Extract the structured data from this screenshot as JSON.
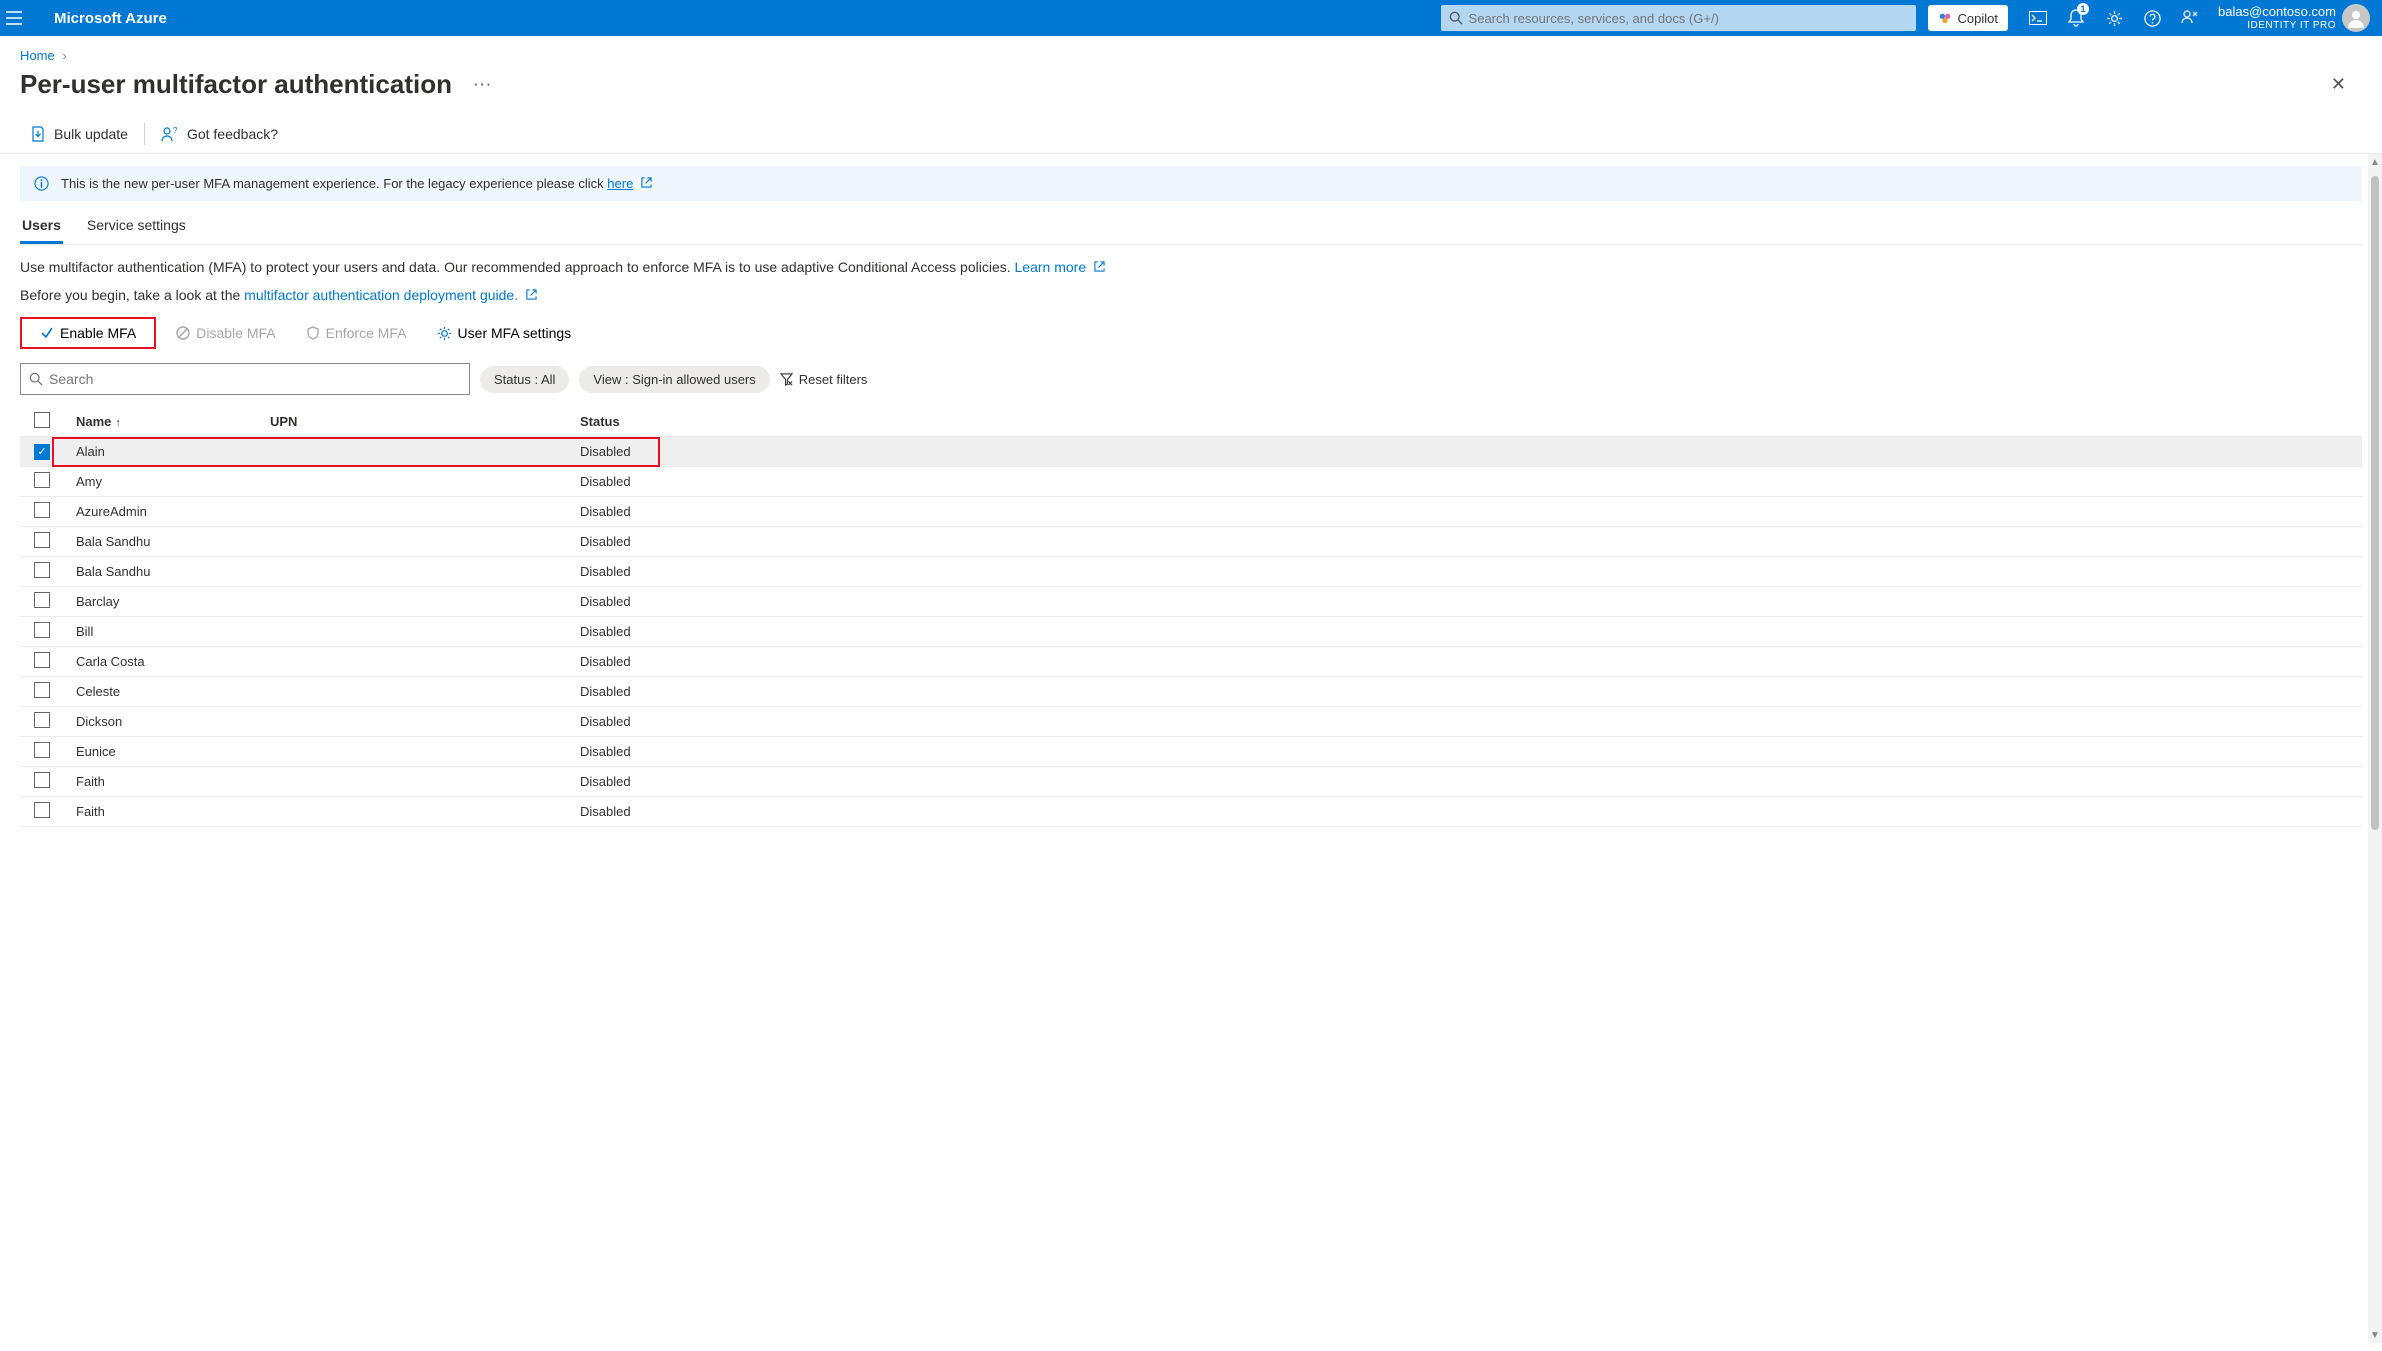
{
  "header": {
    "brand": "Microsoft Azure",
    "search_placeholder": "Search resources, services, and docs (G+/)",
    "copilot_label": "Copilot",
    "notification_badge": "1",
    "account_email": "balas@contoso.com",
    "account_role": "IDENTITY IT PRO"
  },
  "breadcrumb": {
    "home": "Home"
  },
  "page": {
    "title": "Per-user multifactor authentication"
  },
  "commandbar": {
    "bulk_update": "Bulk update",
    "got_feedback": "Got feedback?"
  },
  "banner": {
    "text_prefix": "This is the new per-user MFA management experience. For the legacy experience please click",
    "link_text": "here"
  },
  "tabs": {
    "users": "Users",
    "service_settings": "Service settings"
  },
  "desc": {
    "line1a": "Use multifactor authentication (MFA) to protect your users and data. Our recommended approach to enforce MFA is to use adaptive Conditional Access policies. ",
    "learn_more": "Learn more",
    "line2a": "Before you begin, take a look at the ",
    "guide_link": "multifactor authentication deployment guide."
  },
  "actions": {
    "enable_mfa": "Enable MFA",
    "disable_mfa": "Disable MFA",
    "enforce_mfa": "Enforce MFA",
    "user_mfa_settings": "User MFA settings"
  },
  "filters": {
    "search_placeholder": "Search",
    "status_pill": "Status : All",
    "view_pill": "View : Sign-in allowed users",
    "reset": "Reset filters"
  },
  "table": {
    "headers": {
      "name": "Name",
      "upn": "UPN",
      "status": "Status"
    },
    "rows": [
      {
        "name": "Alain",
        "upn": "",
        "status": "Disabled",
        "checked": true
      },
      {
        "name": "Amy",
        "upn": "",
        "status": "Disabled",
        "checked": false
      },
      {
        "name": "AzureAdmin",
        "upn": "",
        "status": "Disabled",
        "checked": false
      },
      {
        "name": "Bala Sandhu",
        "upn": "",
        "status": "Disabled",
        "checked": false
      },
      {
        "name": "Bala Sandhu",
        "upn": "",
        "status": "Disabled",
        "checked": false
      },
      {
        "name": "Barclay",
        "upn": "",
        "status": "Disabled",
        "checked": false
      },
      {
        "name": "Bill",
        "upn": "",
        "status": "Disabled",
        "checked": false
      },
      {
        "name": "Carla Costa",
        "upn": "",
        "status": "Disabled",
        "checked": false
      },
      {
        "name": "Celeste",
        "upn": "",
        "status": "Disabled",
        "checked": false
      },
      {
        "name": "Dickson",
        "upn": "",
        "status": "Disabled",
        "checked": false
      },
      {
        "name": "Eunice",
        "upn": "",
        "status": "Disabled",
        "checked": false
      },
      {
        "name": "Faith",
        "upn": "",
        "status": "Disabled",
        "checked": false
      },
      {
        "name": "Faith",
        "upn": "",
        "status": "Disabled",
        "checked": false
      }
    ]
  }
}
